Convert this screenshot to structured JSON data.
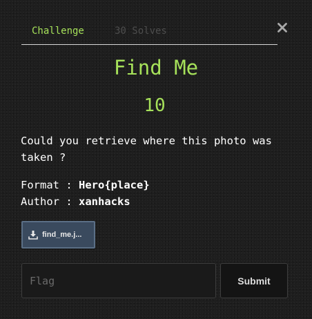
{
  "tabs": [
    {
      "label": "Challenge",
      "active": true
    },
    {
      "label": "30 Solves",
      "active": false
    }
  ],
  "close_icon": "close-icon",
  "challenge": {
    "name": "Find Me",
    "points": "10",
    "description": "Could you retrieve where this photo was taken ?",
    "format_label": "Format : ",
    "format_value": "Hero{place}",
    "author_label": "Author : ",
    "author_value": "xanhacks"
  },
  "files": [
    {
      "label": "find_me.j...",
      "icon": "download-icon"
    }
  ],
  "flag_form": {
    "placeholder": "Flag",
    "value": "",
    "submit_label": "Submit"
  },
  "colors": {
    "accent": "#a6e15a",
    "background": "#1e1e1e",
    "file_button": "#3a4a5e",
    "muted_tab": "#4d4d4d"
  }
}
